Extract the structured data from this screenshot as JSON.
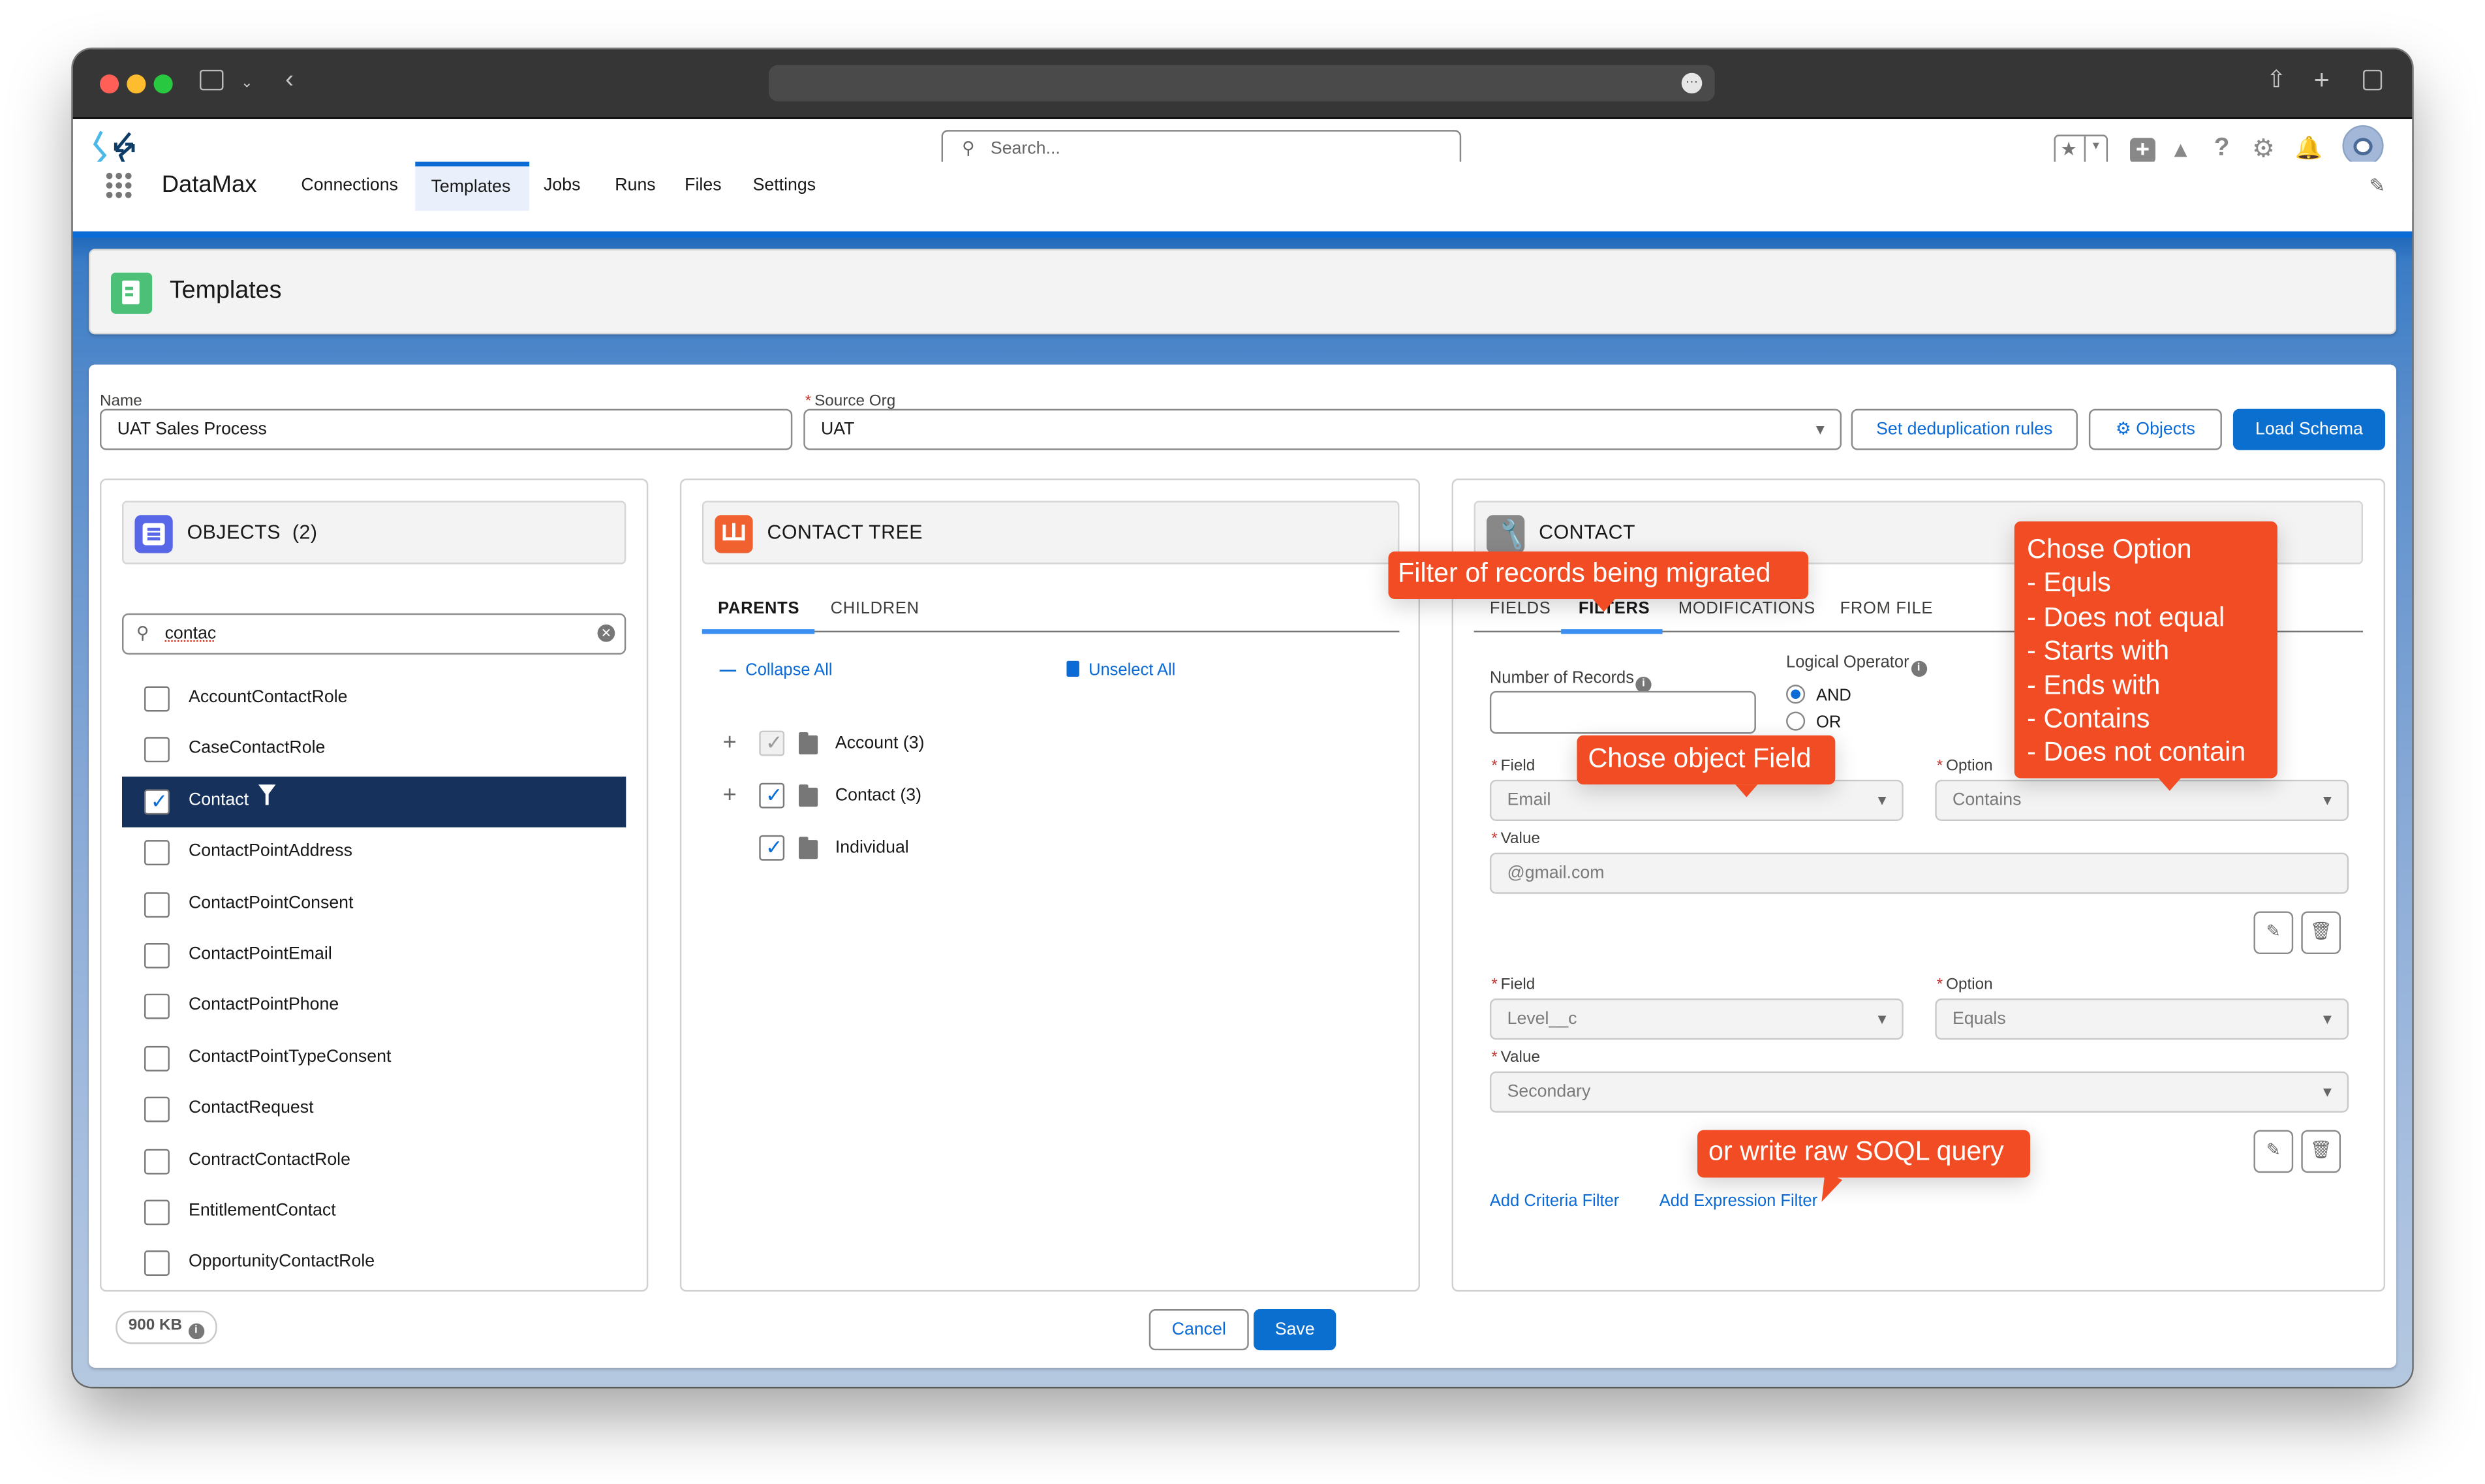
{
  "browser": {
    "traffic_lights": {
      "close": "#ff5f57",
      "minimize": "#febc2e",
      "zoom": "#28c840"
    },
    "icons": [
      "sidebar-icon",
      "chevron-down-icon",
      "back-icon",
      "more-icon",
      "share-icon",
      "new-tab-icon",
      "tabs-icon"
    ]
  },
  "app": {
    "name": "DataMax",
    "search_placeholder": "Search...",
    "nav": [
      {
        "label": "Connections",
        "active": false
      },
      {
        "label": "Templates",
        "active": true
      },
      {
        "label": "Jobs",
        "active": false
      },
      {
        "label": "Runs",
        "active": false
      },
      {
        "label": "Files",
        "active": false
      },
      {
        "label": "Settings",
        "active": false
      }
    ],
    "header_icons": [
      "favorites-star-icon",
      "favorites-dropdown-icon",
      "global-actions-plus-icon",
      "trailhead-icon",
      "help-icon",
      "setup-gear-icon",
      "notifications-bell-icon",
      "user-avatar"
    ],
    "colors": {
      "brand": "#0b6fd0",
      "selected_row": "#16325c",
      "callout": "#f24c24"
    }
  },
  "page": {
    "title": "Templates"
  },
  "form": {
    "name_label": "Name",
    "name_value": "UAT Sales Process",
    "source_org_label": "Source Org",
    "source_org_value": "UAT",
    "dedup_button": "Set deduplication rules",
    "objects_button": "Objects",
    "load_schema_button": "Load Schema"
  },
  "objects_panel": {
    "title": "OBJECTS",
    "count": "(2)",
    "search_value": "contac",
    "items": [
      {
        "label": "AccountContactRole",
        "checked": false,
        "selected": false
      },
      {
        "label": "CaseContactRole",
        "checked": false,
        "selected": false
      },
      {
        "label": "Contact",
        "checked": true,
        "selected": true,
        "filtered": true
      },
      {
        "label": "ContactPointAddress",
        "checked": false,
        "selected": false
      },
      {
        "label": "ContactPointConsent",
        "checked": false,
        "selected": false
      },
      {
        "label": "ContactPointEmail",
        "checked": false,
        "selected": false
      },
      {
        "label": "ContactPointPhone",
        "checked": false,
        "selected": false
      },
      {
        "label": "ContactPointTypeConsent",
        "checked": false,
        "selected": false
      },
      {
        "label": "ContactRequest",
        "checked": false,
        "selected": false
      },
      {
        "label": "ContractContactRole",
        "checked": false,
        "selected": false
      },
      {
        "label": "EntitlementContact",
        "checked": false,
        "selected": false
      },
      {
        "label": "OpportunityContactRole",
        "checked": false,
        "selected": false
      }
    ]
  },
  "tree_panel": {
    "title": "CONTACT TREE",
    "tabs": [
      {
        "label": "PARENTS",
        "active": true
      },
      {
        "label": "CHILDREN",
        "active": false
      }
    ],
    "collapse_all": "Collapse All",
    "unselect_all": "Unselect All",
    "nodes": [
      {
        "label": "Account (3)",
        "expandable": true,
        "checked": true,
        "disabled": true
      },
      {
        "label": "Contact (3)",
        "expandable": true,
        "checked": true,
        "disabled": false
      },
      {
        "label": "Individual",
        "expandable": false,
        "checked": true,
        "disabled": false
      }
    ]
  },
  "detail_panel": {
    "title": "CONTACT",
    "tabs": [
      {
        "label": "FIELDS",
        "active": false
      },
      {
        "label": "FILTERS",
        "active": true
      },
      {
        "label": "MODIFICATIONS",
        "active": false
      },
      {
        "label": "FROM FILE",
        "active": false
      }
    ],
    "number_of_records_label": "Number of Records",
    "number_of_records_value": "",
    "logical_operator_label": "Logical Operator",
    "logical_operator_options": [
      {
        "label": "AND",
        "selected": true
      },
      {
        "label": "OR",
        "selected": false
      }
    ],
    "filters": [
      {
        "field_label": "Field",
        "field_value": "Email",
        "option_label": "Option",
        "option_value": "Contains",
        "value_label": "Value",
        "value_value": "@gmail.com",
        "value_is_select": false
      },
      {
        "field_label": "Field",
        "field_value": "Level__c",
        "option_label": "Option",
        "option_value": "Equals",
        "value_label": "Value",
        "value_value": "Secondary",
        "value_is_select": true
      }
    ],
    "add_criteria_filter": "Add Criteria Filter",
    "add_expression_filter": "Add Expression Filter"
  },
  "footer": {
    "size_badge": "900 KB",
    "cancel": "Cancel",
    "save": "Save"
  },
  "annotations": {
    "filter_records": "Filter of records being migrated",
    "chose_field": "Chose object Field",
    "chose_option_title": "Chose Option",
    "chose_option_items": [
      "- Equls",
      "- Does not equal",
      "- Starts with",
      "- Ends with",
      "- Contains",
      "- Does not contain"
    ],
    "soql": "or write raw SOQL query"
  }
}
